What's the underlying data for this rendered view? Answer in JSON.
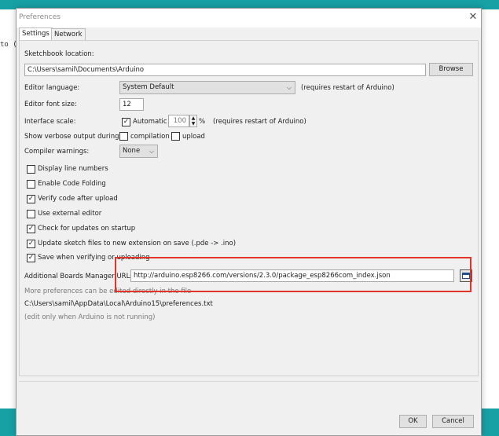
{
  "window": {
    "title": "Preferences"
  },
  "tabs": [
    {
      "label": "Settings"
    },
    {
      "label": "Network"
    }
  ],
  "background": {
    "code_fragment": "to ("
  },
  "sketchbook": {
    "label": "Sketchbook location:",
    "value": "C:\\Users\\samil\\Documents\\Arduino",
    "browse": "Browse"
  },
  "editor_language": {
    "label": "Editor language:",
    "value": "System Default",
    "note": "(requires restart of Arduino)"
  },
  "font_size": {
    "label": "Editor font size:",
    "value": "12"
  },
  "interface_scale": {
    "label": "Interface scale:",
    "automatic": "Automatic",
    "value": "100",
    "unit": "%",
    "note": "(requires restart of Arduino)"
  },
  "verbose": {
    "label": "Show verbose output during:",
    "compilation": "compilation",
    "upload": "upload"
  },
  "warnings": {
    "label": "Compiler warnings:",
    "value": "None"
  },
  "options": [
    {
      "label": "Display line numbers",
      "checked": false
    },
    {
      "label": "Enable Code Folding",
      "checked": false
    },
    {
      "label": "Verify code after upload",
      "checked": true
    },
    {
      "label": "Use external editor",
      "checked": false
    },
    {
      "label": "Check for updates on startup",
      "checked": true
    },
    {
      "label": "Update sketch files to new extension on save (.pde -> .ino)",
      "checked": true
    },
    {
      "label": "Save when verifying or uploading",
      "checked": true
    }
  ],
  "boards_urls": {
    "label": "Additional Boards Manager URLs:",
    "value": "http://arduino.esp8266.com/versions/2.3.0/package_esp8266com_index.json"
  },
  "more_prefs": {
    "text": "More preferences can be edited directly in the file",
    "path": "C:\\Users\\samil\\AppData\\Local\\Arduino15\\preferences.txt",
    "note": "(edit only when Arduino is not running)"
  },
  "buttons": {
    "ok": "OK",
    "cancel": "Cancel"
  },
  "colors": {
    "accent": "#17a1a5",
    "highlight": "#e03528"
  }
}
